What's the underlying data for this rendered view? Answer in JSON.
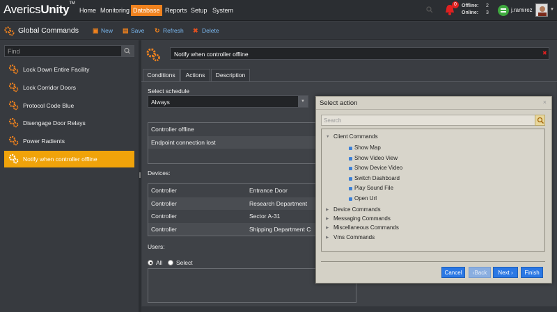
{
  "app": {
    "logo_light": "Averics",
    "logo_bold": "Unity",
    "logo_tm": "TM",
    "nav": [
      "Home",
      "Monitoring",
      "Database",
      "Reports",
      "Setup",
      "System"
    ],
    "nav_active": "Database",
    "notifications_count": "0",
    "offline_label": "Offline:",
    "offline_value": "2",
    "online_label": "Online:",
    "online_value": "3",
    "username": "j.ramirez"
  },
  "toolbar": {
    "title": "Global Commands",
    "new_label": "New",
    "save_label": "Save",
    "refresh_label": "Refresh",
    "delete_label": "Delete"
  },
  "sidebar": {
    "find_placeholder": "Find",
    "items": [
      {
        "label": "Lock Down Entire Facility"
      },
      {
        "label": "Lock Corridor Doors"
      },
      {
        "label": "Protocol Code Blue"
      },
      {
        "label": "Disengage Door Relays"
      },
      {
        "label": "Power Radients"
      },
      {
        "label": "Notify when controller offline"
      }
    ],
    "selected_index": 5
  },
  "main": {
    "rule_name": "Notify when controller offline",
    "tabs": [
      "Conditions",
      "Actions",
      "Description"
    ],
    "active_tab": "Conditions",
    "schedule_label": "Select schedule",
    "schedule_value": "Always",
    "conditions": [
      "Controller offline",
      "Endpoint connection lost"
    ],
    "devices_label": "Devices:",
    "devices": [
      {
        "type": "Controller",
        "name": "Entrance Door"
      },
      {
        "type": "Controller",
        "name": "Research Department"
      },
      {
        "type": "Controller",
        "name": "Sector A-31"
      },
      {
        "type": "Controller",
        "name": "Shipping Department C"
      }
    ],
    "users_label": "Users:",
    "users_all": "All",
    "users_select": "Select"
  },
  "modal": {
    "title": "Select action",
    "close": "×",
    "search_placeholder": "Search",
    "tree": [
      {
        "label": "Client Commands",
        "expanded": true,
        "children": [
          "Show Map",
          "Show Video View",
          "Show Device Video",
          "Switch Dashboard",
          "Play Sound File",
          "Open Url"
        ]
      },
      {
        "label": "Device Commands",
        "expanded": false
      },
      {
        "label": "Messaging Commands",
        "expanded": false
      },
      {
        "label": "Miscellaneous Commands",
        "expanded": false
      },
      {
        "label": "Vms Commands",
        "expanded": false
      }
    ],
    "buttons": {
      "cancel": "Cancel",
      "back": "Back",
      "next": "Next",
      "finish": "Finish"
    }
  },
  "colors": {
    "accent_orange": "#f0821e",
    "selected_item": "#f0a30a",
    "button_blue": "#2b78e4"
  }
}
